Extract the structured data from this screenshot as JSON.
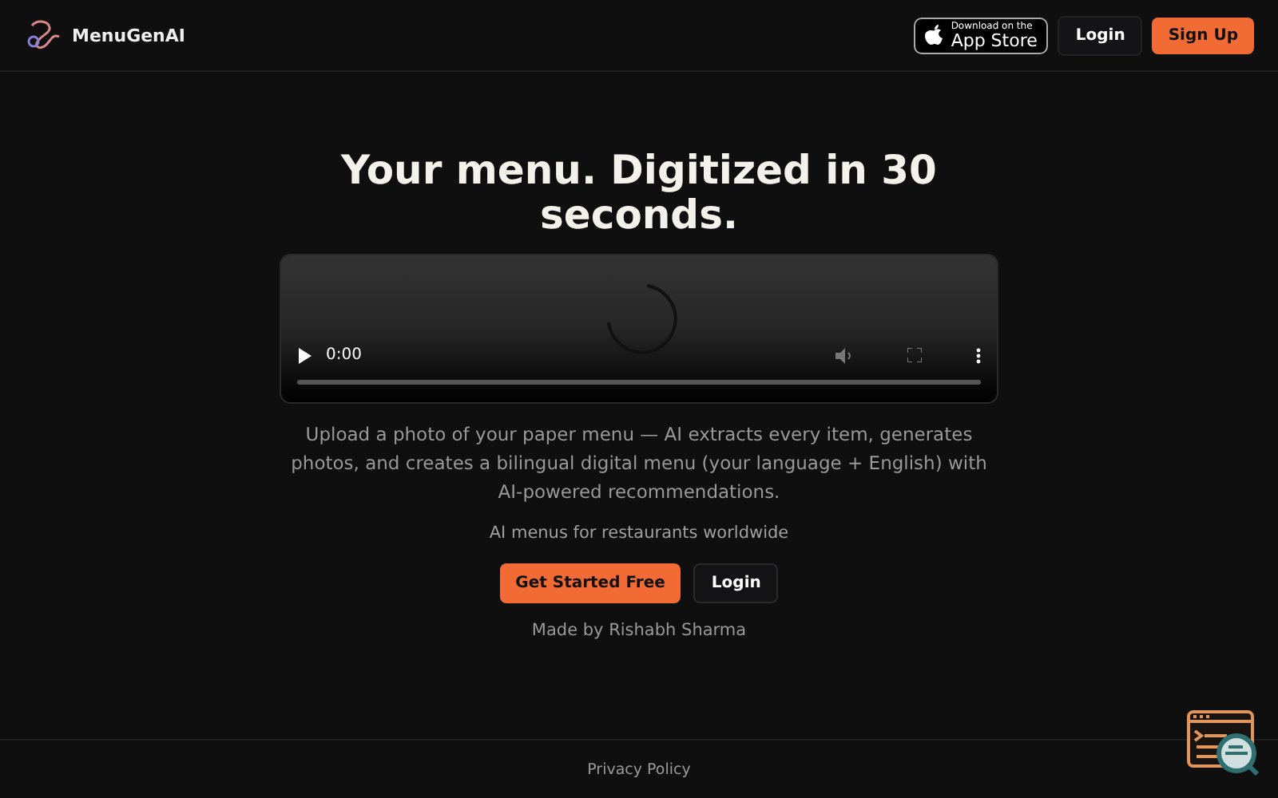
{
  "header": {
    "brand": "MenuGenAI",
    "app_store": {
      "small": "Download on the",
      "big": "App Store"
    },
    "login": "Login",
    "signup": "Sign Up"
  },
  "hero": {
    "title": "Your menu. Digitized in 30 seconds.",
    "video": {
      "time": "0:00"
    },
    "description": "Upload a photo of your paper menu — AI extracts every item, generates photos, and creates a bilingual digital menu (your language + English) with AI-powered recommendations.",
    "tagline": "AI menus for restaurants worldwide",
    "primary": "Get Started Free",
    "secondary": "Login",
    "credit": "Made by Rishabh Sharma"
  },
  "footer": {
    "link": "Privacy Policy"
  }
}
